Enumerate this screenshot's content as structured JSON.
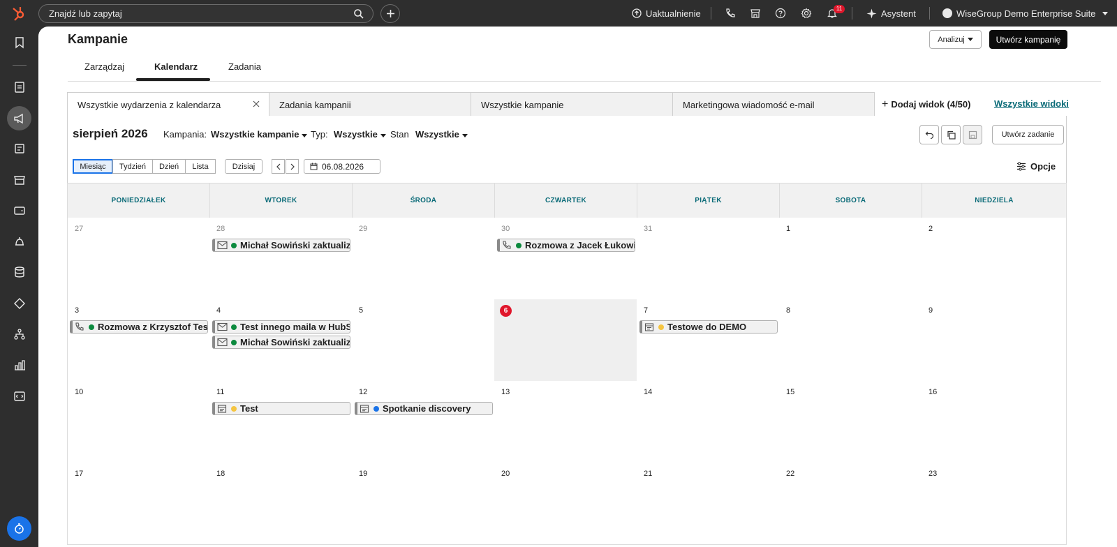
{
  "topbar": {
    "search_placeholder": "Znajdź lub zapytaj",
    "upgrade_label": "Uaktualnienie",
    "notifications_count": "11",
    "assistant_label": "Asystent",
    "account_label": "WiseGroup Demo Enterprise Suite"
  },
  "header": {
    "title": "Kampanie",
    "analyze_label": "Analizuj",
    "create_campaign_label": "Utwórz kampanię"
  },
  "tabs": [
    "Zarządzaj",
    "Kalendarz",
    "Zadania"
  ],
  "views": {
    "tabs": [
      "Wszystkie wydarzenia z kalendarza",
      "Zadania kampanii",
      "Wszystkie kampanie",
      "Marketingowa wiadomość e-mail"
    ],
    "add_view_label": "Dodaj widok (4/50)",
    "all_views_label": "Wszystkie widoki"
  },
  "filters": {
    "month_label": "sierpień 2026",
    "campaign_label": "Kampania:",
    "campaign_value": "Wszystkie kampanie",
    "type_label": "Typ:",
    "type_value": "Wszystkie",
    "status_label": "Stan",
    "status_value": "Wszystkie",
    "create_task_label": "Utwórz zadanie"
  },
  "toolbar": {
    "view_modes": [
      "Miesiąc",
      "Tydzień",
      "Dzień",
      "Lista"
    ],
    "today_label": "Dzisiaj",
    "date_value": "06.08.2026",
    "options_label": "Opcje"
  },
  "calendar": {
    "weekdays": [
      "PONIEDZIAŁEK",
      "WTOREK",
      "ŚRODA",
      "CZWARTEK",
      "PIĄTEK",
      "SOBOTA",
      "NIEDZIELA"
    ],
    "days": [
      "27",
      "28",
      "29",
      "30",
      "31",
      "1",
      "2",
      "3",
      "4",
      "5",
      "6",
      "7",
      "8",
      "9",
      "10",
      "11",
      "12",
      "13",
      "14",
      "15",
      "16",
      "17",
      "18",
      "19",
      "20",
      "21",
      "22",
      "23"
    ],
    "today": "6",
    "events": {
      "e1": "Michał Sowiński zaktualizował",
      "e2": "Rozmowa z Jacek Łukowiak",
      "e3": "Rozmowa z Krzysztof Testowy",
      "e4": "Test innego maila w HubSpot",
      "e5": "Michał Sowiński zaktualizował",
      "e6": "Testowe do DEMO",
      "e7": "Test",
      "e8": "Spotkanie discovery"
    },
    "status_colors": {
      "green": "#0c8a3e",
      "yellow": "#f5c542",
      "blue": "#1a73e8"
    }
  }
}
